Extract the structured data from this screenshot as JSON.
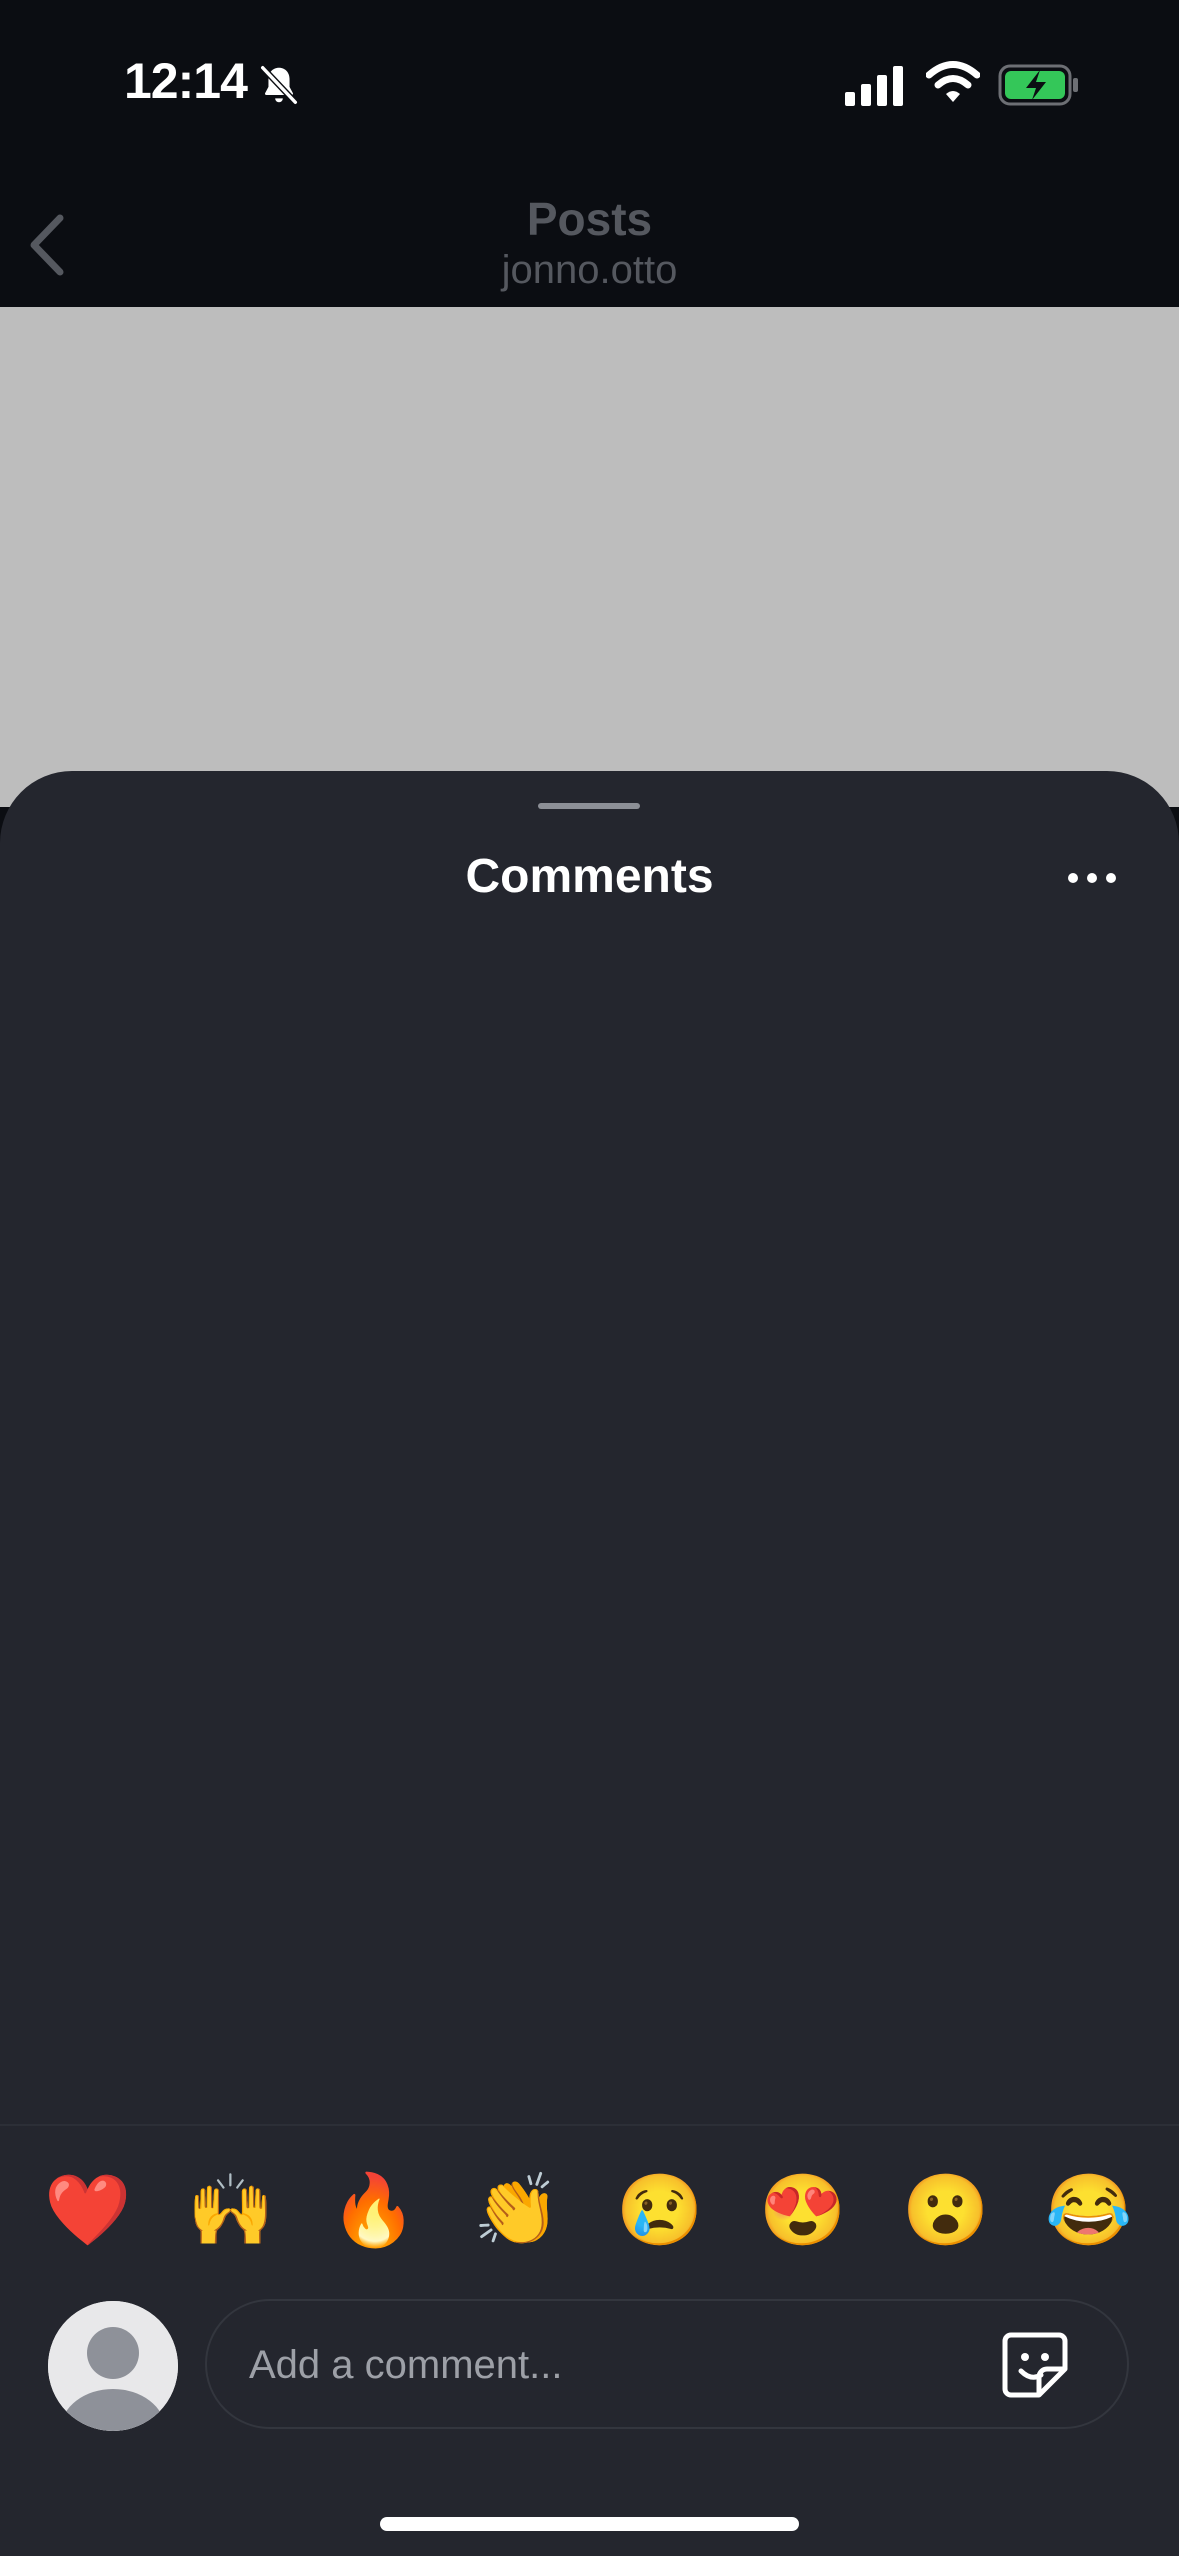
{
  "status_bar": {
    "time": "12:14",
    "icons": [
      "bell-slash-icon",
      "cellular-signal-icon",
      "wifi-icon",
      "battery-charging-icon"
    ],
    "battery_color": "#34c759"
  },
  "nav": {
    "title": "Posts",
    "subtitle": "jonno.otto",
    "back_icon": "chevron-left-icon"
  },
  "sheet": {
    "title": "Comments",
    "more_icon": "more-horizontal-icon",
    "background": "#24262e"
  },
  "quick_reactions": [
    "❤️",
    "🙌",
    "🔥",
    "👏",
    "😢",
    "😍",
    "😮",
    "😂"
  ],
  "composer": {
    "avatar_icon": "default-avatar-icon",
    "placeholder": "Add a comment...",
    "sticker_icon": "sticker-icon"
  }
}
